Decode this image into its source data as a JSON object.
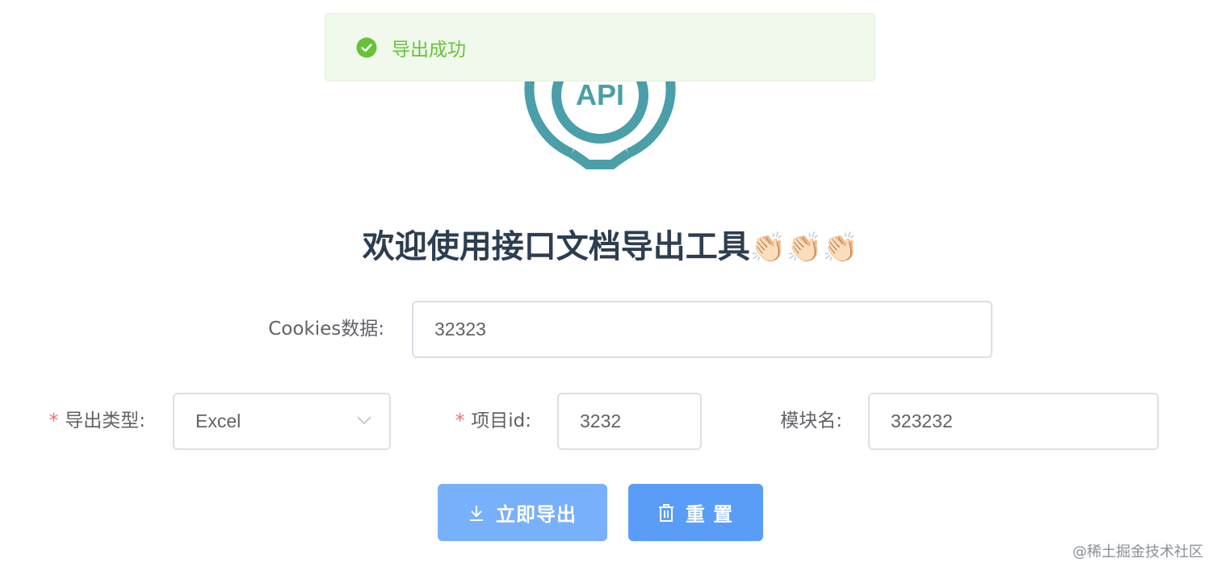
{
  "toast": {
    "message": "导出成功",
    "icon": "check-circle-icon",
    "color": "#67c23a"
  },
  "logo": {
    "text": "API",
    "color": "#4a9fa8"
  },
  "title": "欢迎使用接口文档导出工具",
  "title_emoji": "👏🏻👏🏻👏🏻",
  "form": {
    "cookies": {
      "label": "Cookies数据:",
      "value": "32323"
    },
    "export_type": {
      "label": "导出类型:",
      "required_mark": "*",
      "value": "Excel"
    },
    "project_id": {
      "label": "项目id:",
      "required_mark": "*",
      "value": "3232"
    },
    "module_name": {
      "label": "模块名:",
      "value": "323232"
    }
  },
  "buttons": {
    "export": {
      "label": "立即导出",
      "icon": "download-icon"
    },
    "reset": {
      "label": "重 置",
      "icon": "trash-icon"
    }
  },
  "watermark": "@稀土掘金技术社区"
}
